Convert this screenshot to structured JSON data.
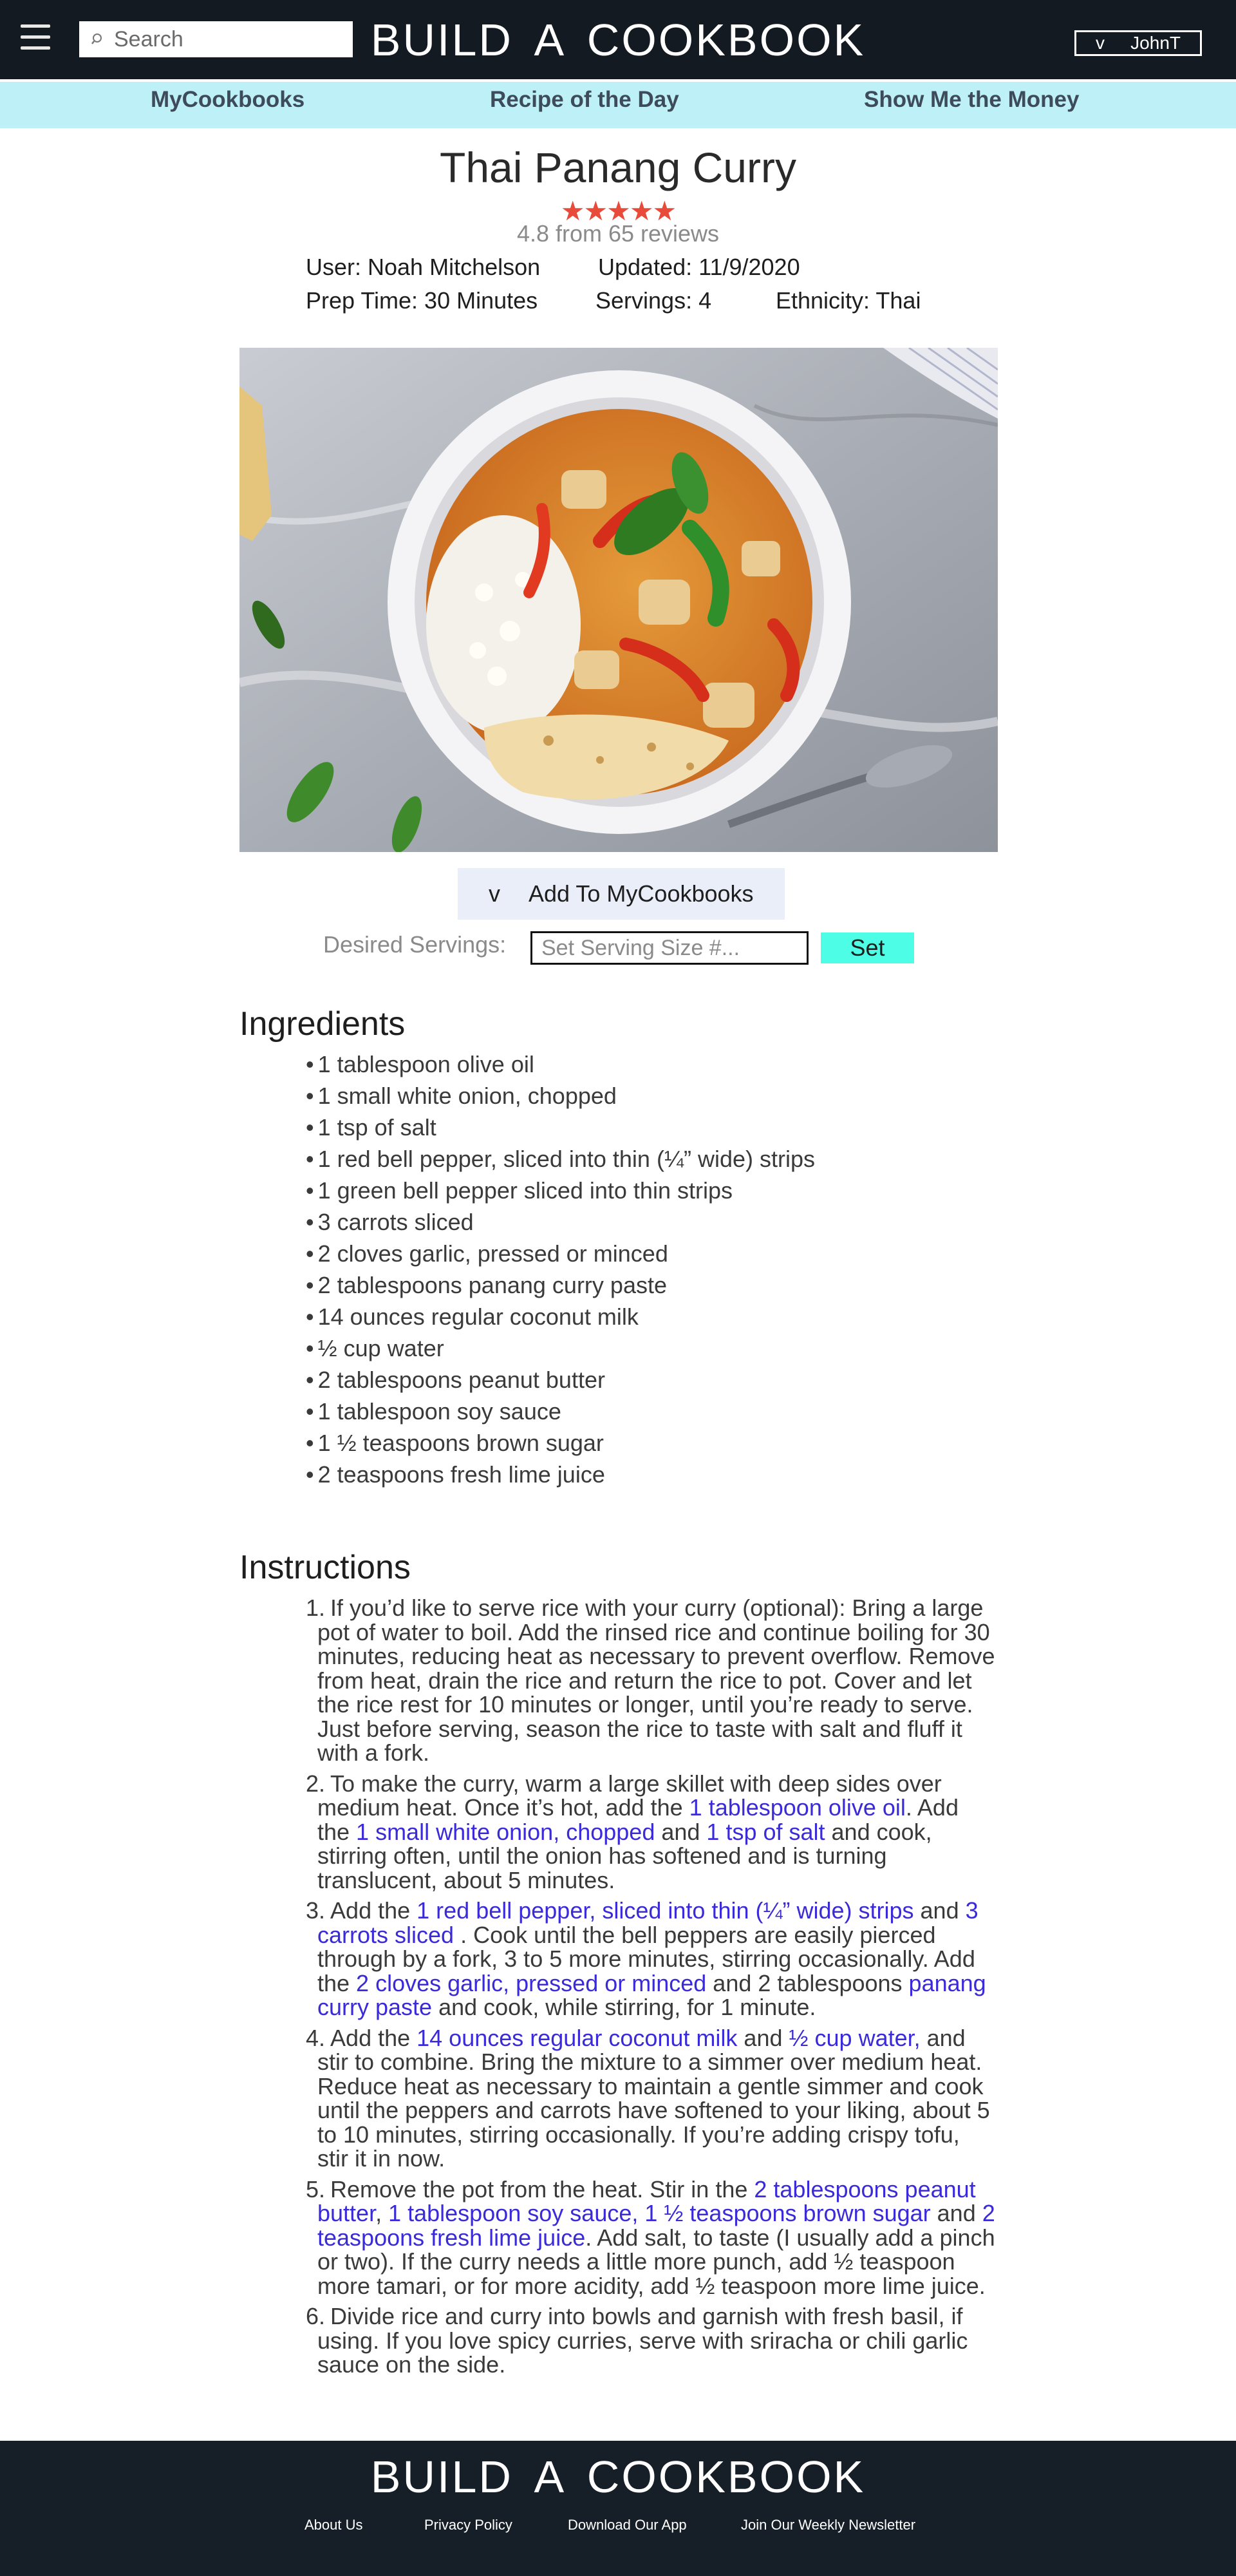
{
  "header": {
    "search_placeholder": "Search",
    "site_title": "BUILD A COOKBOOK",
    "user_dropdown_caret": "v",
    "user_name": "JohnT"
  },
  "nav": {
    "items": [
      "MyCookbooks",
      "Recipe of the Day",
      "Show Me the Money"
    ]
  },
  "recipe": {
    "title": "Thai Panang Curry",
    "stars": "★★★★★",
    "rating_text": "4.8 from 65 reviews",
    "user": "User: Noah Mitchelson",
    "updated": "Updated: 11/9/2020",
    "prep_time": "Prep Time: 30 Minutes",
    "servings": "Servings: 4",
    "ethnicity": "Ethnicity: Thai"
  },
  "actions": {
    "add_caret": "v",
    "add_label": "Add To MyCookbooks",
    "servings_label": "Desired Servings:",
    "servings_placeholder": "Set Serving Size #...",
    "set_label": "Set"
  },
  "ingredients": {
    "heading": "Ingredients",
    "items": [
      "1 tablespoon olive oil",
      "1 small white onion, chopped",
      "1 tsp of salt",
      "1 red bell pepper, sliced into thin (¼” wide) strips",
      "1 green bell pepper sliced into thin strips",
      "3 carrots sliced",
      "2 cloves garlic, pressed or minced",
      "2 tablespoons panang curry paste",
      "14 ounces regular coconut milk",
      "½ cup water",
      "2 tablespoons peanut butter",
      "1 tablespoon soy sauce",
      "1 ½ teaspoons brown sugar",
      "2 teaspoons fresh lime juice"
    ]
  },
  "instructions": {
    "heading": "Instructions",
    "steps": [
      {
        "num": "1.",
        "lines": [
          [
            {
              "t": "If you’d like to serve rice with your curry (optional): Bring a large"
            }
          ],
          [
            {
              "t": "pot of water to boil. Add the rinsed rice and continue boiling for 30"
            }
          ],
          [
            {
              "t": "minutes, reducing heat as necessary to prevent overflow. Remove"
            }
          ],
          [
            {
              "t": "from heat, drain the rice and return the rice to pot. Cover and let"
            }
          ],
          [
            {
              "t": "the rice rest for 10 minutes or longer, until you’re ready to serve."
            }
          ],
          [
            {
              "t": "Just before serving, season the rice to taste with salt and fluff it"
            }
          ],
          [
            {
              "t": "with a fork."
            }
          ]
        ]
      },
      {
        "num": "2.",
        "lines": [
          [
            {
              "t": "To make the curry, warm a large skillet with deep sides over"
            }
          ],
          [
            {
              "t": "medium heat. Once it’s hot, add the "
            },
            {
              "t": "1 tablespoon olive oil",
              "h": true
            },
            {
              "t": ". Add"
            }
          ],
          [
            {
              "t": "the "
            },
            {
              "t": "1 small white onion, chopped",
              "h": true
            },
            {
              "t": " and "
            },
            {
              "t": "1 tsp of salt",
              "h": true
            },
            {
              "t": " and cook,"
            }
          ],
          [
            {
              "t": "stirring often, until the onion has softened and is turning"
            }
          ],
          [
            {
              "t": "translucent, about 5 minutes."
            }
          ]
        ]
      },
      {
        "num": "3.",
        "lines": [
          [
            {
              "t": "Add the "
            },
            {
              "t": "1 red bell pepper, sliced into thin (¼” wide) strips",
              "h": true
            },
            {
              "t": " and "
            },
            {
              "t": "3",
              "h": true
            }
          ],
          [
            {
              "t": "carrots sliced",
              "h": true
            },
            {
              "t": " . Cook until the bell peppers are easily pierced"
            }
          ],
          [
            {
              "t": "through by a fork, 3 to 5 more minutes, stirring occasionally. Add"
            }
          ],
          [
            {
              "t": "the "
            },
            {
              "t": "2 cloves garlic, pressed or minced",
              "h": true
            },
            {
              "t": " and 2 tablespoons "
            },
            {
              "t": "panang",
              "h": true
            }
          ],
          [
            {
              "t": "curry paste",
              "h": true
            },
            {
              "t": " and cook, while stirring, for 1 minute."
            }
          ]
        ]
      },
      {
        "num": "4.",
        "lines": [
          [
            {
              "t": "Add the "
            },
            {
              "t": "14 ounces regular coconut milk",
              "h": true
            },
            {
              "t": " and "
            },
            {
              "t": "½ cup water,",
              "h": true
            },
            {
              "t": " and"
            }
          ],
          [
            {
              "t": "stir to combine. Bring the mixture to a simmer over medium heat."
            }
          ],
          [
            {
              "t": "Reduce heat as necessary to maintain a gentle simmer and cook"
            }
          ],
          [
            {
              "t": "until the peppers and carrots have softened to your liking, about 5"
            }
          ],
          [
            {
              "t": "to 10 minutes, stirring occasionally. If you’re adding crispy tofu,"
            }
          ],
          [
            {
              "t": "stir it in now."
            }
          ]
        ]
      },
      {
        "num": "5.",
        "lines": [
          [
            {
              "t": "Remove the pot from the heat. Stir in the "
            },
            {
              "t": "2 tablespoons peanut",
              "h": true
            }
          ],
          [
            {
              "t": "butter",
              "h": true
            },
            {
              "t": ", "
            },
            {
              "t": "1 tablespoon soy sauce, 1 ½ teaspoons brown sugar",
              "h": true
            },
            {
              "t": " and "
            },
            {
              "t": "2",
              "h": true
            }
          ],
          [
            {
              "t": "teaspoons fresh lime juice",
              "h": true
            },
            {
              "t": ". Add salt, to taste (I usually add a pinch"
            }
          ],
          [
            {
              "t": "or two). If the curry needs a little more punch, add ½ teaspoon"
            }
          ],
          [
            {
              "t": "more tamari, or for more acidity, add ½ teaspoon more lime juice."
            }
          ]
        ]
      },
      {
        "num": "6.",
        "lines": [
          [
            {
              "t": "Divide rice and curry into bowls and garnish with fresh basil, if"
            }
          ],
          [
            {
              "t": "using. If you love spicy curries, serve with sriracha or chili garlic"
            }
          ],
          [
            {
              "t": "sauce on the side."
            }
          ]
        ]
      }
    ]
  },
  "footer": {
    "title": "BUILD A COOKBOOK",
    "links": [
      "About Us",
      "Privacy Policy",
      "Download Our App",
      "Join Our Weekly Newsletter"
    ]
  },
  "colors": {
    "header_bg": "#131a21",
    "nav_bg": "#bdf0f7",
    "stars": "#e94b3a",
    "ingredient_link": "#3a2ad8",
    "set_button": "#4efde6",
    "add_button": "#e9eef9",
    "footer_bg": "#161f28"
  }
}
